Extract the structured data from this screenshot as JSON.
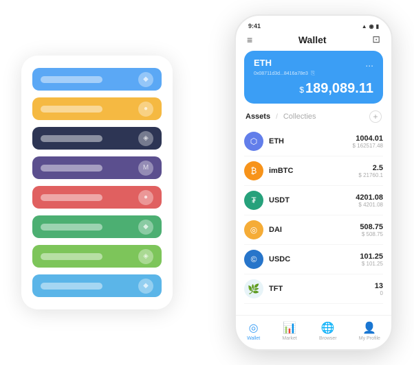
{
  "scene": {
    "bgPanel": {
      "cards": [
        {
          "id": "card-blue",
          "colorClass": "card-blue",
          "iconText": "◆"
        },
        {
          "id": "card-yellow",
          "colorClass": "card-yellow",
          "iconText": "●"
        },
        {
          "id": "card-dark",
          "colorClass": "card-dark",
          "iconText": "◈"
        },
        {
          "id": "card-purple",
          "colorClass": "card-purple",
          "iconText": "M"
        },
        {
          "id": "card-red",
          "colorClass": "card-red",
          "iconText": "●"
        },
        {
          "id": "card-green",
          "colorClass": "card-green",
          "iconText": "◆"
        },
        {
          "id": "card-lightgreen",
          "colorClass": "card-lightgreen",
          "iconText": "◈"
        },
        {
          "id": "card-lightblue",
          "colorClass": "card-lightblue",
          "iconText": "◆"
        }
      ]
    },
    "phone": {
      "statusBar": {
        "time": "9:41",
        "icons": "▲ ◉ ▮"
      },
      "header": {
        "menuIcon": "≡",
        "title": "Wallet",
        "scanIcon": "⊡"
      },
      "ethCard": {
        "label": "ETH",
        "address": "0x08711d3d...8416a78e3",
        "copyIcon": "⎘",
        "dotsLabel": "...",
        "balancePrefix": "$",
        "balance": "189,089.11"
      },
      "assetsTabs": {
        "activeTab": "Assets",
        "divider": "/",
        "inactiveTab": "Collecties",
        "addIconLabel": "+"
      },
      "assets": [
        {
          "id": "eth",
          "name": "ETH",
          "iconText": "⬡",
          "iconClass": "eth-icon",
          "amount": "1004.01",
          "usd": "$ 162517.48"
        },
        {
          "id": "imbtc",
          "name": "imBTC",
          "iconText": "₿",
          "iconClass": "imbtc-icon",
          "amount": "2.5",
          "usd": "$ 21760.1"
        },
        {
          "id": "usdt",
          "name": "USDT",
          "iconText": "₮",
          "iconClass": "usdt-icon",
          "amount": "4201.08",
          "usd": "$ 4201.08"
        },
        {
          "id": "dai",
          "name": "DAI",
          "iconText": "◎",
          "iconClass": "dai-icon",
          "amount": "508.75",
          "usd": "$ 508.75"
        },
        {
          "id": "usdc",
          "name": "USDC",
          "iconText": "©",
          "iconClass": "usdc-icon",
          "amount": "101.25",
          "usd": "$ 101.25"
        },
        {
          "id": "tft",
          "name": "TFT",
          "iconText": "🌿",
          "iconClass": "tft-icon",
          "amount": "13",
          "usd": "0"
        }
      ],
      "bottomNav": [
        {
          "id": "wallet",
          "icon": "◎",
          "label": "Wallet",
          "active": true
        },
        {
          "id": "market",
          "icon": "📊",
          "label": "Market",
          "active": false
        },
        {
          "id": "browser",
          "icon": "🌐",
          "label": "Browser",
          "active": false
        },
        {
          "id": "profile",
          "icon": "👤",
          "label": "My Profile",
          "active": false
        }
      ]
    }
  }
}
